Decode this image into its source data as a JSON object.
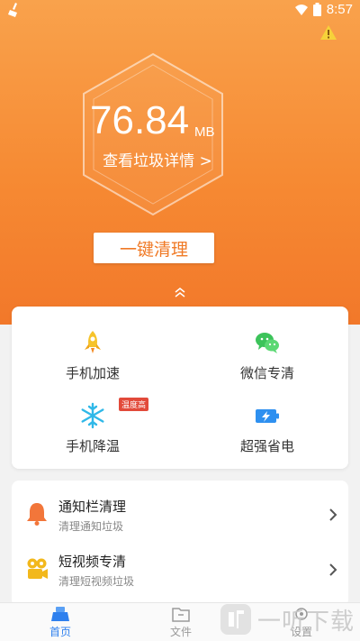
{
  "status_bar": {
    "time": "8:57"
  },
  "hero": {
    "size_value": "76.84",
    "size_unit": "MB",
    "detail_link": "查看垃圾详情 >",
    "clean_button": "一键清理"
  },
  "features": [
    {
      "label": "手机加速",
      "icon": "rocket-icon"
    },
    {
      "label": "微信专清",
      "icon": "wechat-icon"
    },
    {
      "label": "手机降温",
      "icon": "snowflake-icon",
      "badge": "温度高"
    },
    {
      "label": "超强省电",
      "icon": "battery-icon"
    }
  ],
  "list": [
    {
      "title": "通知栏清理",
      "subtitle": "清理通知垃圾",
      "icon": "bell-icon"
    },
    {
      "title": "短视频专清",
      "subtitle": "清理短视频垃圾",
      "icon": "video-icon"
    }
  ],
  "tabs": [
    {
      "label": "首页",
      "active": true
    },
    {
      "label": "文件",
      "active": false
    },
    {
      "label": "设置",
      "active": false
    }
  ],
  "watermark": {
    "text": "一听下载"
  },
  "colors": {
    "accent": "#f68a33",
    "tab_active": "#2e80ee"
  }
}
